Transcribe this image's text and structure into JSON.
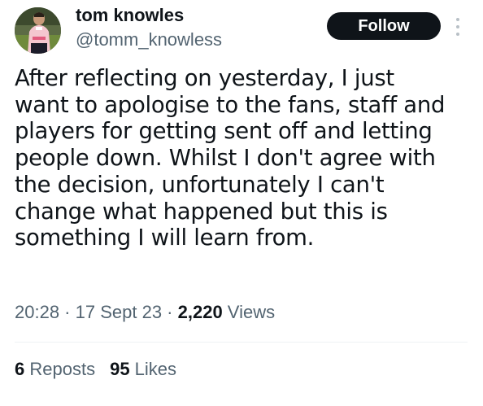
{
  "author": {
    "display_name": "tom knowles",
    "handle": "@tomm_knowless",
    "avatar_icon": "profile-photo"
  },
  "follow_button": {
    "label": "Follow"
  },
  "more_icon": "vertical-ellipsis-icon",
  "tweet": {
    "lines": [
      "After reflecting on yesterday, I just",
      "want to apologise to the fans, staff and",
      "players for getting sent off and letting",
      "people down. Whilst I don't agree with",
      "the decision, unfortunately I can't",
      "change what happened but this is",
      "something I will learn from."
    ]
  },
  "meta": {
    "time": "20:28",
    "separator": " · ",
    "date": "17 Sept 23",
    "views_count": "2,220",
    "views_label": " Views"
  },
  "stats": {
    "reposts_count": "6",
    "reposts_label": " Reposts",
    "likes_count": "95",
    "likes_label": " Likes"
  },
  "colors": {
    "text_primary": "#0f1419",
    "text_secondary": "#536471",
    "button_bg": "#0f1419",
    "button_text": "#ffffff",
    "divider": "#eff3f4"
  }
}
